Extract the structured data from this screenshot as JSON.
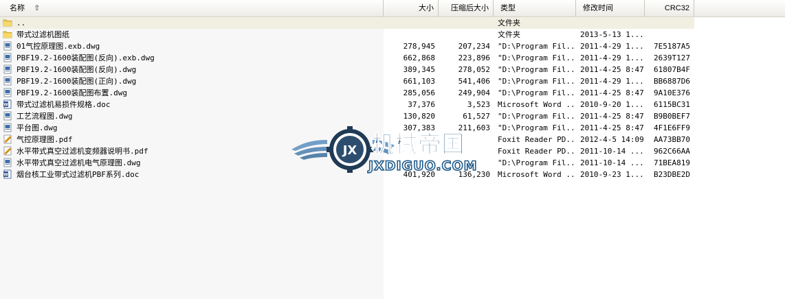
{
  "header": {
    "name": "名称",
    "size": "大小",
    "compressed": "压缩后大小",
    "type": "类型",
    "modified": "修改时间",
    "crc": "CRC32",
    "sort_icon": "sort-up-arrow-icon"
  },
  "rows": [
    {
      "icon": "folder-up-icon",
      "name": "..",
      "size": "",
      "compressed": "",
      "type": "文件夹",
      "modified": "",
      "crc": ""
    },
    {
      "icon": "folder-icon",
      "name": "带式过滤机图纸",
      "size": "",
      "compressed": "",
      "type": "文件夹",
      "modified": "2013-5-13 1...",
      "crc": ""
    },
    {
      "icon": "dwg-file-icon",
      "name": "01气控原理图.exb.dwg",
      "size": "278,945",
      "compressed": "207,234",
      "type": "\"D:\\Program Fil...",
      "modified": "2011-4-29 1...",
      "crc": "7E5187A5"
    },
    {
      "icon": "dwg-file-icon",
      "name": "PBF19.2-1600装配图(反向).exb.dwg",
      "size": "662,868",
      "compressed": "223,896",
      "type": "\"D:\\Program Fil...",
      "modified": "2011-4-29 1...",
      "crc": "2639T127"
    },
    {
      "icon": "dwg-file-icon",
      "name": "PBF19.2-1600装配图(反向).dwg",
      "size": "389,345",
      "compressed": "278,052",
      "type": "\"D:\\Program Fil...",
      "modified": "2011-4-25 8:47",
      "crc": "61807B4F"
    },
    {
      "icon": "dwg-file-icon",
      "name": "PBF19.2-1600装配图(正向).dwg",
      "size": "661,103",
      "compressed": "541,406",
      "type": "\"D:\\Program Fil...",
      "modified": "2011-4-29 1...",
      "crc": "BB6887D6"
    },
    {
      "icon": "dwg-file-icon",
      "name": "PBF19.2-1600装配图布置.dwg",
      "size": "285,056",
      "compressed": "249,904",
      "type": "\"D:\\Program Fil...",
      "modified": "2011-4-25 8:47",
      "crc": "9A10E376"
    },
    {
      "icon": "word-doc-icon",
      "name": "带式过滤机易损件规格.doc",
      "size": "37,376",
      "compressed": "3,523",
      "type": "Microsoft Word ...",
      "modified": "2010-9-20 1...",
      "crc": "6115BC31"
    },
    {
      "icon": "dwg-file-icon",
      "name": "工艺流程图.dwg",
      "size": "130,820",
      "compressed": "61,527",
      "type": "\"D:\\Program Fil...",
      "modified": "2011-4-25 8:47",
      "crc": "B9B0BEF7"
    },
    {
      "icon": "dwg-file-icon",
      "name": "平台图.dwg",
      "size": "307,383",
      "compressed": "211,603",
      "type": "\"D:\\Program Fil...",
      "modified": "2011-4-25 8:47",
      "crc": "4F1E6FF9"
    },
    {
      "icon": "pdf-file-icon",
      "name": "气控原理图.pdf",
      "size": "",
      "compressed": "",
      "type": "Foxit Reader PD...",
      "modified": "2012-4-5 14:09",
      "crc": "AA73BB70"
    },
    {
      "icon": "pdf-file-icon",
      "name": "水平带式真空过滤机变频器说明书.pdf",
      "size": "",
      "compressed": "",
      "type": "Foxit Reader PD...",
      "modified": "2011-10-14 ...",
      "crc": "962C66AA"
    },
    {
      "icon": "dwg-file-icon",
      "name": "水平带式真空过滤机电气原理图.dwg",
      "size": "",
      "compressed": "",
      "type": "\"D:\\Program Fil...",
      "modified": "2011-10-14 ...",
      "crc": "71BEA819"
    },
    {
      "icon": "word-doc-icon",
      "name": "烟台核工业带式过滤机PBF系列.doc",
      "size": "401,920",
      "compressed": "136,230",
      "type": "Microsoft Word ...",
      "modified": "2010-9-23 1...",
      "crc": "B23DBE2D"
    }
  ],
  "watermark": {
    "title": "机械帝国",
    "url": "JXDIGUO.COM",
    "emblem": "jx-gear-wings-logo-icon",
    "colors": {
      "brand": "#1f5a8a",
      "wing": "#4a7fb0"
    }
  },
  "colors": {
    "folder": "#f2c94c",
    "header_bg": "#ecebe6",
    "parent_row": "#f1efe2"
  }
}
